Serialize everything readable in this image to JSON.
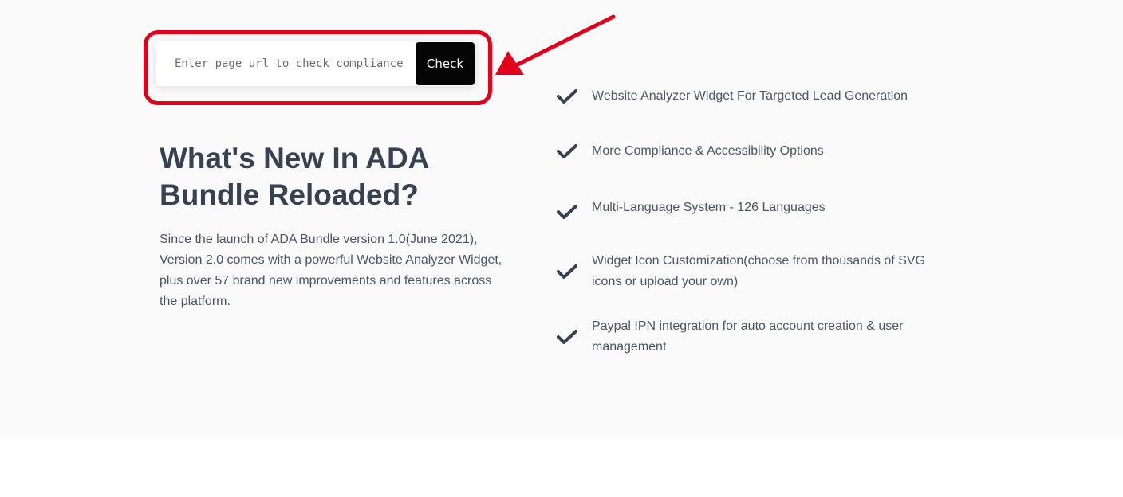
{
  "url_checker": {
    "placeholder": "Enter page url to check compliance",
    "button_label": "Check"
  },
  "annotation": {
    "highlight_color": "#e3001b"
  },
  "whats_new": {
    "heading": "What's New In ADA Bundle Reloaded?",
    "description": "Since the launch of ADA Bundle version 1.0(June 2021), Version 2.0 comes with a powerful Website Analyzer Widget, plus over 57 brand new improvements and features across the platform."
  },
  "features": [
    {
      "icon": "checkmark-icon",
      "text": "Website Analyzer Widget For Targeted Lead Generation"
    },
    {
      "icon": "checkmark-icon",
      "text": "More Compliance & Accessibility Options"
    },
    {
      "icon": "checkmark-icon",
      "text": "Multi-Language System - 126 Languages"
    },
    {
      "icon": "checkmark-icon",
      "text": "Widget Icon Customization(choose from thousands of SVG icons or upload your own)"
    },
    {
      "icon": "checkmark-icon",
      "text": "Paypal IPN integration for auto account creation & user management"
    }
  ],
  "colors": {
    "section_background": "#fafafb",
    "heading": "#374151",
    "body_text": "#4b5563",
    "button_background": "#050505"
  }
}
